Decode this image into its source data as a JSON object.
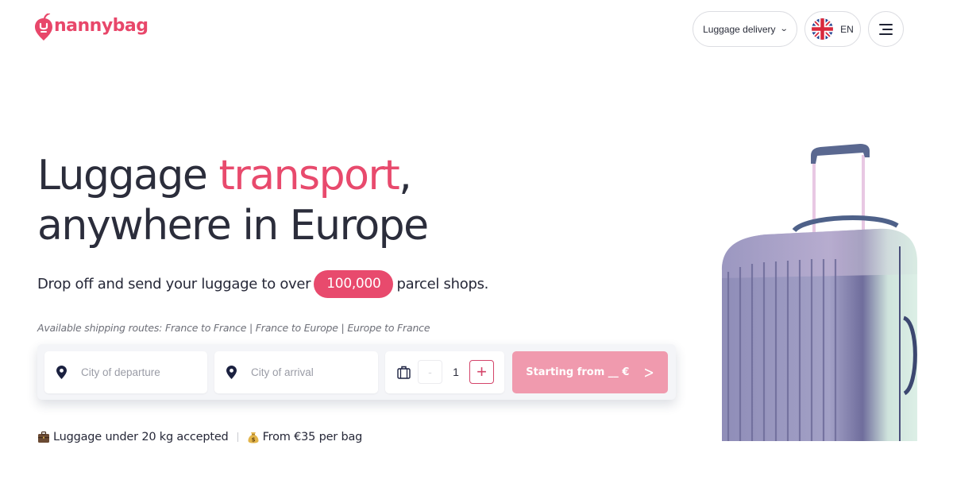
{
  "brand": {
    "name": "nannybag",
    "color": "#e8476a"
  },
  "nav": {
    "delivery_label": "Luggage delivery",
    "delivery_icon": "chevron-down-icon",
    "language_label": "EN",
    "language_flag": "uk-flag-icon",
    "menu_icon": "hamburger-menu-icon"
  },
  "hero": {
    "headline_part1": "Luggage ",
    "headline_accent": "transport",
    "headline_part2": ",",
    "headline_line2": "anywhere in Europe",
    "subline_before": "Drop off and send your luggage to over",
    "subline_badge": "100,000",
    "subline_after": "parcel shops.",
    "routes": "Available shipping routes: France to France | France to Europe | Europe to France",
    "accent_color": "#e84a6d"
  },
  "search": {
    "departure_placeholder": "City of departure",
    "departure_value": "",
    "arrival_placeholder": "City of arrival",
    "arrival_value": "",
    "bags_icon": "suitcase-icon",
    "minus_label": "-",
    "plus_label": "+",
    "quantity": "1",
    "cta_label": "Starting from __ €",
    "cta_icon": "chevron-right-icon",
    "cta_color": "#f09aae"
  },
  "features": [
    {
      "icon": "briefcase-emoji-icon",
      "label": "Luggage under 20 kg accepted"
    },
    {
      "icon": "money-bag-emoji-icon",
      "label": "From €35 per bag"
    }
  ]
}
